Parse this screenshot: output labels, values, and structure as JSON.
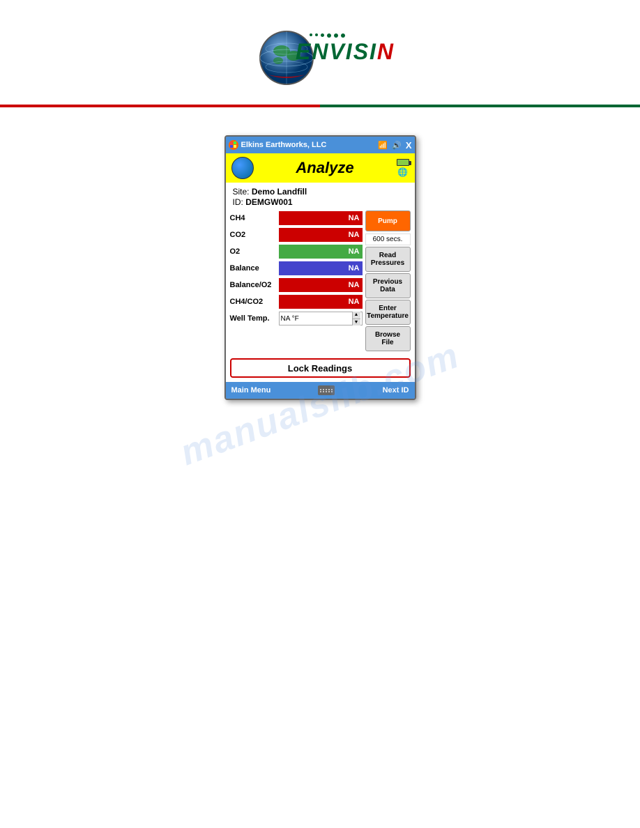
{
  "logo": {
    "brand": "ENVISI",
    "brand_n": "N",
    "tagline": ""
  },
  "titlebar": {
    "app_name": "Elkins Earthworks, LLC",
    "close": "X"
  },
  "header": {
    "title": "Analyze"
  },
  "site": {
    "site_label": "Site:",
    "site_value": "Demo Landfill",
    "id_label": "ID:",
    "id_value": "DEMGW001"
  },
  "readings": [
    {
      "label": "CH4",
      "value": "NA",
      "color": "red"
    },
    {
      "label": "CO2",
      "value": "NA",
      "color": "red"
    },
    {
      "label": "O2",
      "value": "NA",
      "color": "green"
    },
    {
      "label": "Balance",
      "value": "NA",
      "color": "blue"
    },
    {
      "label": "Balance/O2",
      "value": "NA",
      "color": "red"
    },
    {
      "label": "CH4/CO2",
      "value": "NA",
      "color": "red"
    }
  ],
  "well_temp": {
    "label": "Well Temp.",
    "value": "NA °F"
  },
  "buttons": {
    "pump": "Pump",
    "pump_secs": "600 secs.",
    "read_pressures": "Read\nPressures",
    "previous_data": "Previous\nData",
    "enter_temperature": "Enter\nTemperature",
    "browse_file": "Browse\nFile",
    "lock_readings": "Lock Readings"
  },
  "nav": {
    "left": "Main Menu",
    "right": "Next ID"
  },
  "watermark": "manualslib.com"
}
